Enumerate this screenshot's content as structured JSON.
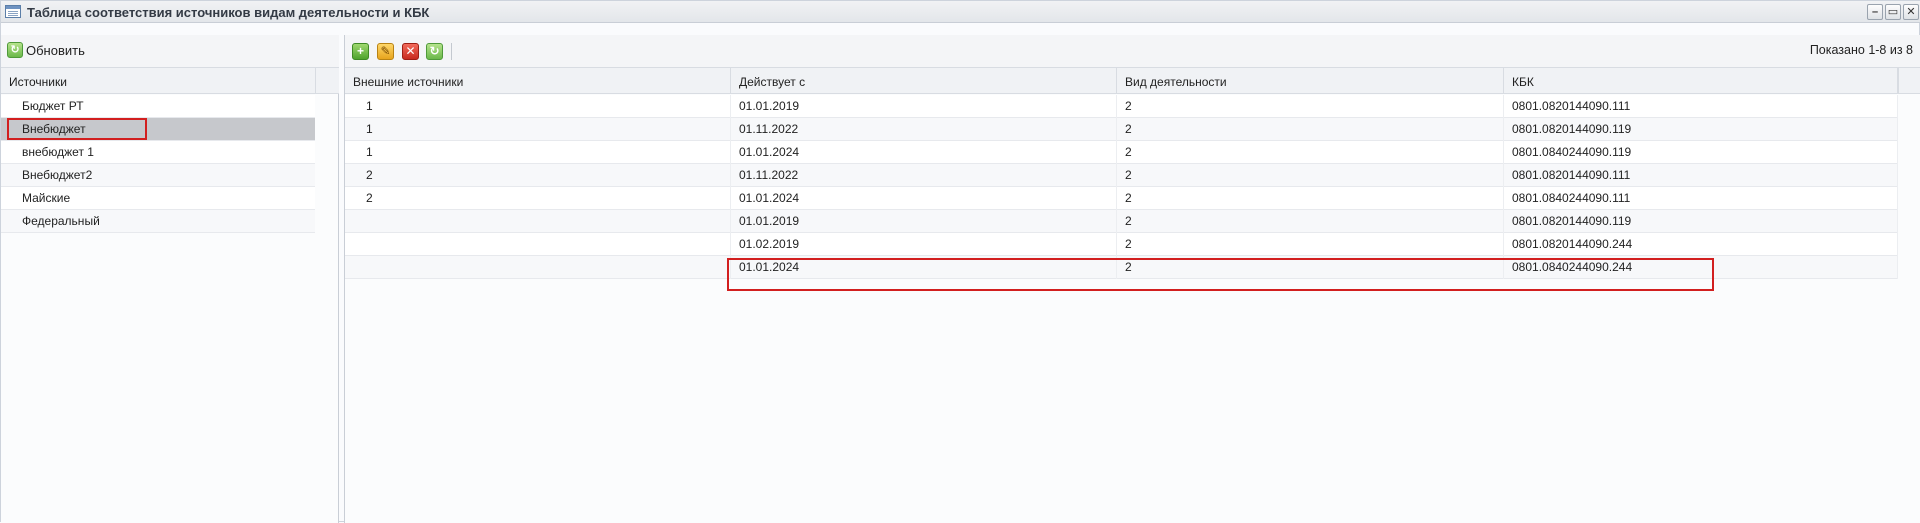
{
  "window": {
    "title": "Таблица соответствия источников видам деятельности и КБК",
    "buttons": [
      "–",
      "▭",
      "✕"
    ]
  },
  "left": {
    "refresh_label": "Обновить",
    "column_header": "Источники",
    "items": [
      {
        "label": "Бюджет РТ"
      },
      {
        "label": "Внебюджет",
        "selected": true
      },
      {
        "label": "внебюджет 1"
      },
      {
        "label": "Внебюджет2"
      },
      {
        "label": "Майские"
      },
      {
        "label": "Федеральный"
      }
    ]
  },
  "right": {
    "toolbar": {
      "icons": [
        "add-icon",
        "edit-icon",
        "delete-icon",
        "refresh-icon"
      ],
      "paging": "Показано 1-8 из 8"
    },
    "columns": [
      "Внешние источники",
      "Действует с",
      "Вид деятельности",
      "КБК"
    ],
    "rows": [
      [
        "1",
        "01.01.2019",
        "2",
        "0801.0820144090.111"
      ],
      [
        "1",
        "01.11.2022",
        "2",
        "0801.0820144090.119"
      ],
      [
        "1",
        "01.01.2024",
        "2",
        "0801.0840244090.119"
      ],
      [
        "2",
        "01.11.2022",
        "2",
        "0801.0820144090.111"
      ],
      [
        "2",
        "01.01.2024",
        "2",
        "0801.0840244090.111"
      ],
      [
        "",
        "01.01.2019",
        "2",
        "0801.0820144090.119"
      ],
      [
        "",
        "01.02.2019",
        "2",
        "0801.0820144090.244"
      ],
      [
        "",
        "01.01.2024",
        "2",
        "0801.0840244090.244"
      ]
    ]
  },
  "colors": {
    "highlight": "#d21f1f",
    "selected_row": "#c6c8cc"
  }
}
